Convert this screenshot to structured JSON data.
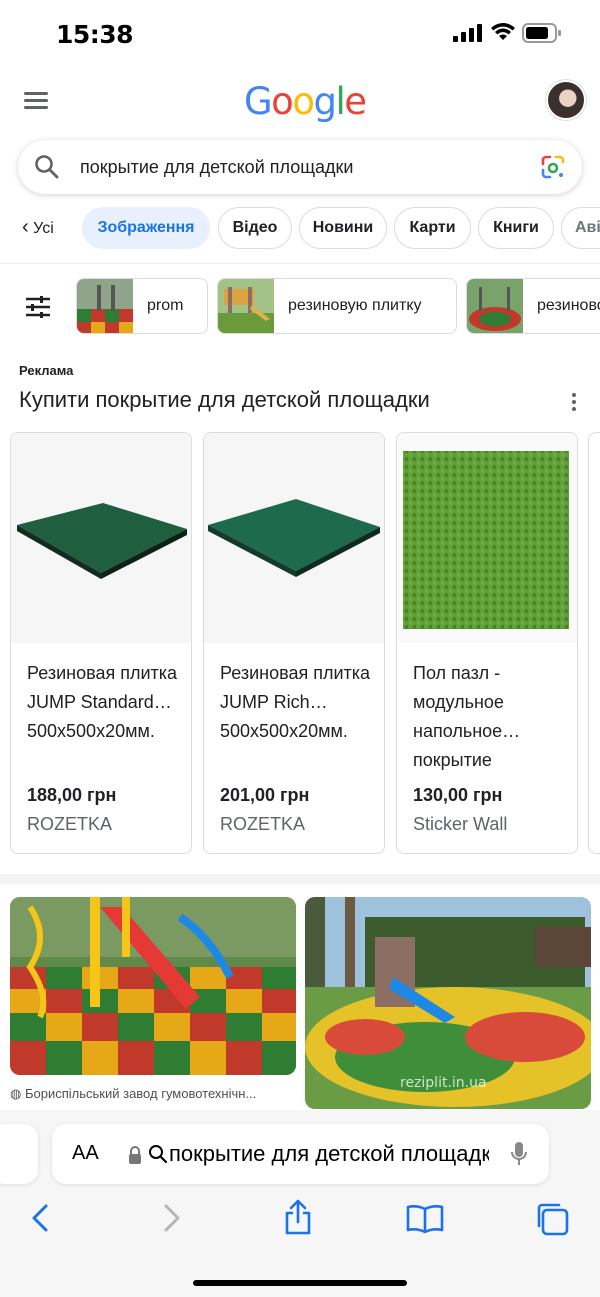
{
  "status": {
    "time": "15:38"
  },
  "header": {
    "logo": [
      "G",
      "o",
      "o",
      "g",
      "l",
      "e"
    ]
  },
  "search": {
    "query": "покрытие для детской площадки"
  },
  "tabs": [
    {
      "label": "Усі"
    },
    {
      "label": "Зображення"
    },
    {
      "label": "Відео"
    },
    {
      "label": "Новини"
    },
    {
      "label": "Карти"
    },
    {
      "label": "Книги"
    },
    {
      "label": "Авіа"
    }
  ],
  "chips": [
    {
      "label": "prom"
    },
    {
      "label": "резиновую плитку"
    },
    {
      "label": "резиновое"
    }
  ],
  "ads": {
    "tag": "Реклама",
    "title": "Купити покрытие для детской площадки",
    "items": [
      {
        "name": "Резиновая плитка JUMP Standard… 500x500x20мм.",
        "price": "188,00 грн",
        "store": "ROZETKA"
      },
      {
        "name": "Резиновая плитка JUMP Rich… 500x500x20мм.",
        "price": "201,00 грн",
        "store": "ROZETKA"
      },
      {
        "name": "Пол пазл - модульное напольное… покрытие",
        "price": "130,00 грн",
        "store": "Sticker Wall"
      }
    ]
  },
  "results": [
    {
      "source": "Бориспільський завод гумовотехнічн..."
    },
    {
      "watermark": "reziplit.in.ua"
    }
  ],
  "safari": {
    "aa": "AA",
    "url": "покрытие для детской площадки"
  },
  "colors": {
    "accent": "#1a73e8",
    "chip_active_bg": "#e8f0fe",
    "text": "#202124",
    "muted": "#5f6368"
  }
}
